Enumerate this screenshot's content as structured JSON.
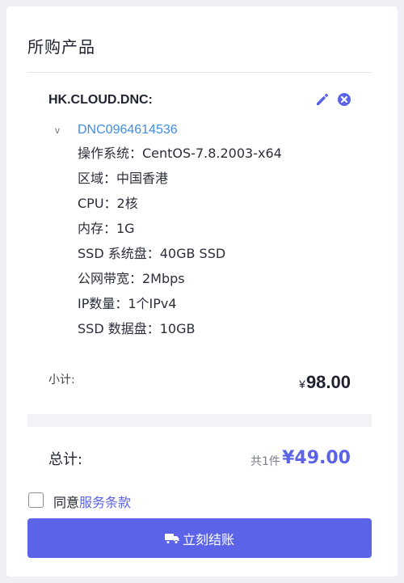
{
  "panel": {
    "title": "所购产品"
  },
  "product": {
    "name": "HK.CLOUD.DNC:",
    "toggle": "v",
    "id": "DNC0964614536",
    "specs": [
      "操作系统：CentOS-7.8.2003-x64",
      "区域：中国香港",
      "CPU：2核",
      "内存：1G",
      "SSD 系统盘：40GB SSD",
      "公网带宽：2Mbps",
      "IP数量：1个IPv4",
      "SSD 数据盘：10GB"
    ],
    "edit_icon": "pencil-icon",
    "remove_icon": "close-circle-icon"
  },
  "subtotal": {
    "label": "小计:",
    "currency": "¥",
    "value": "98.00"
  },
  "total": {
    "label": "总计:",
    "count": "共1件",
    "value": "¥49.00"
  },
  "agreement": {
    "prefix": "同意",
    "link": "服务条款"
  },
  "checkout": {
    "label": "立刻结账",
    "icon": "truck-icon"
  },
  "colors": {
    "accent": "#5b63e8",
    "link": "#3e8ee8",
    "page_bg": "#eef0f4"
  }
}
